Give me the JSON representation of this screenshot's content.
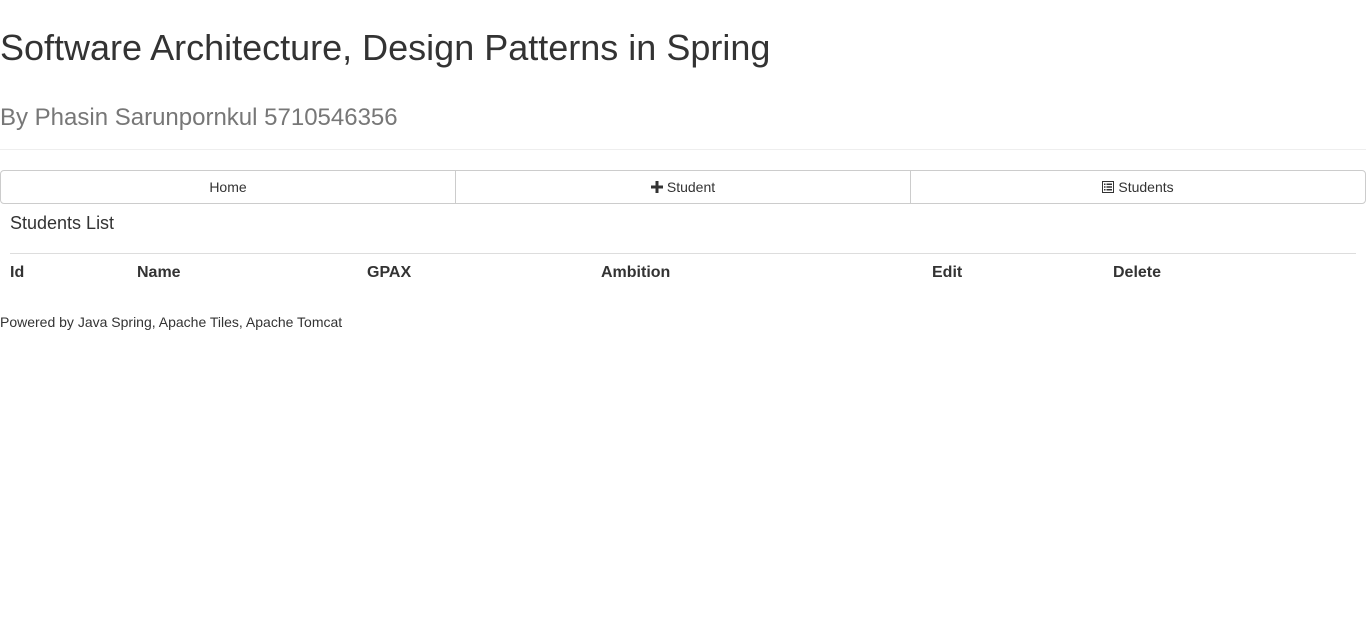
{
  "header": {
    "title": "Software Architecture, Design Patterns in Spring",
    "subtitle": "By Phasin Sarunpornkul 5710546356"
  },
  "nav": {
    "home_label": "Home",
    "add_student_label": "Student",
    "students_label": "Students",
    "add_student_icon": "plus-icon",
    "students_icon": "list-icon"
  },
  "main": {
    "section_title": "Students List",
    "table": {
      "columns": [
        "Id",
        "Name",
        "GPAX",
        "Ambition",
        "Edit",
        "Delete"
      ],
      "rows": []
    }
  },
  "footer": {
    "text": "Powered by Java Spring, Apache Tiles, Apache Tomcat"
  }
}
